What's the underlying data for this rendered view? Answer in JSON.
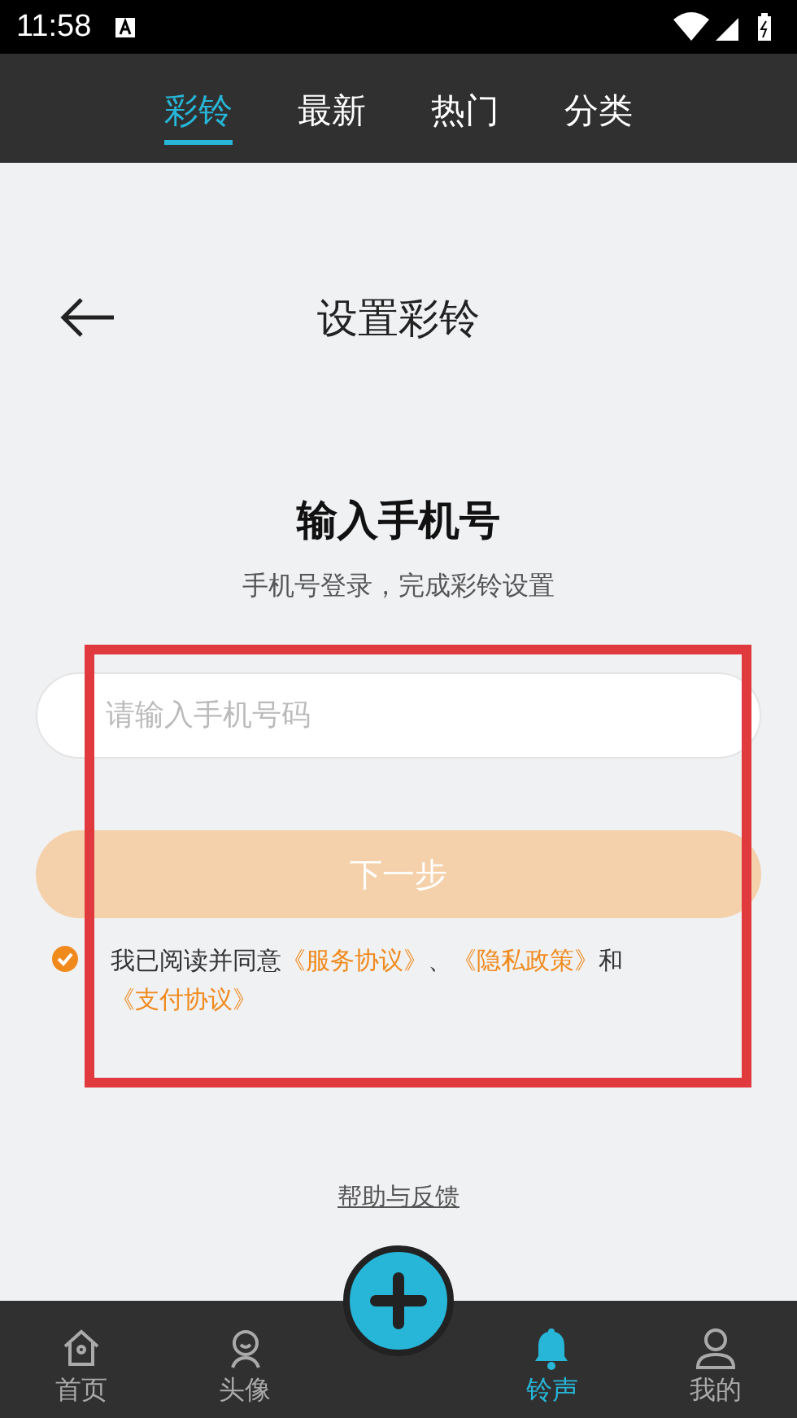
{
  "status_bar": {
    "time": "11:58"
  },
  "tabs": [
    {
      "label": "彩铃",
      "selected": true
    },
    {
      "label": "最新",
      "selected": false
    },
    {
      "label": "热门",
      "selected": false
    },
    {
      "label": "分类",
      "selected": false
    }
  ],
  "header": {
    "title": "设置彩铃"
  },
  "form": {
    "heading": "输入手机号",
    "subtitle": "手机号登录，完成彩铃设置",
    "phone": {
      "placeholder": "请输入手机号码"
    },
    "next_button": {
      "label": "下一步",
      "disabled": true
    },
    "agreement": {
      "checked": true,
      "text": "我已阅读并同意",
      "links": [
        {
          "label": "《服务协议》",
          "sep": "、"
        },
        {
          "label": "《隐私政策》",
          "sep": "和"
        },
        {
          "label": "《支付协议》"
        }
      ]
    }
  },
  "help_link": "帮助与反馈",
  "bottom_nav": [
    {
      "label": "首页",
      "kind": "home",
      "selected": false
    },
    {
      "label": "头像",
      "kind": "avatar",
      "selected": false
    },
    {
      "kind": "add"
    },
    {
      "label": "铃声",
      "kind": "bell",
      "selected": true
    },
    {
      "label": "我的",
      "kind": "profile",
      "selected": false
    }
  ]
}
